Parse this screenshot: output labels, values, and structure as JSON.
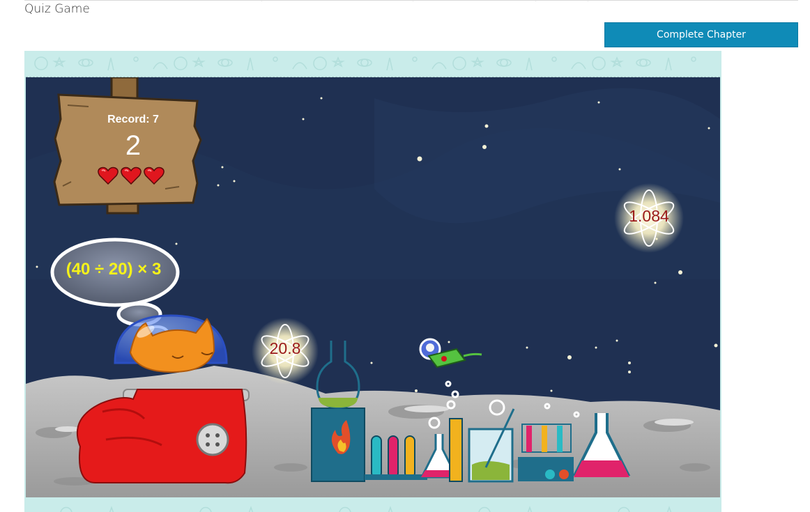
{
  "page": {
    "title": "Quiz Game",
    "complete_button_label": "Complete Chapter"
  },
  "game": {
    "record_label": "Record: 7",
    "score": "2",
    "lives": 3,
    "question": "(40 ÷ 20) × 3",
    "answers": [
      {
        "value": "20.8"
      },
      {
        "value": "1.084"
      }
    ],
    "colors": {
      "sky": "#1f3052",
      "frame": "#c9ecea",
      "question_text": "#f5f21a",
      "answer_text": "#9b1a1a",
      "button": "#0f8bb7",
      "heart": "#e0161e"
    },
    "icons": [
      "sign-board-icon",
      "heart-icon",
      "thought-bubble-icon",
      "cat-astronaut-icon",
      "boot-rocket-icon",
      "atom-icon",
      "alien-ufo-icon",
      "lab-equipment-icon"
    ]
  }
}
